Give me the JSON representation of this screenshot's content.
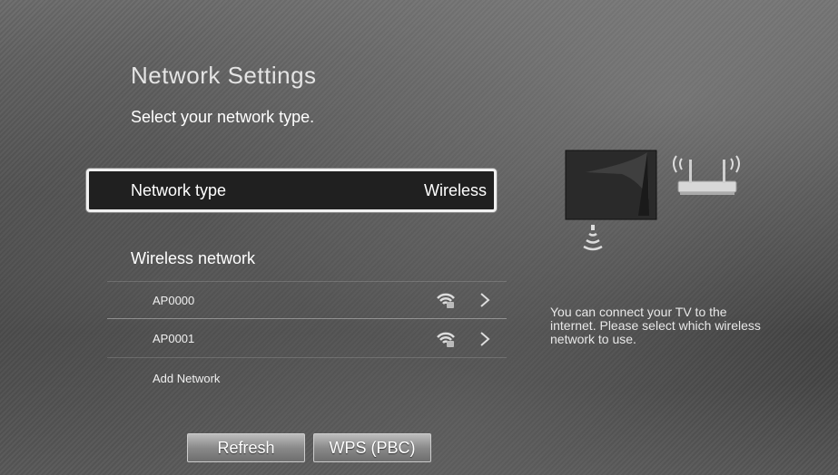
{
  "header": {
    "title": "Network Settings",
    "subtitle": "Select your network type."
  },
  "network_type": {
    "label": "Network type",
    "value": "Wireless"
  },
  "wireless_section": {
    "title": "Wireless network",
    "networks": [
      {
        "name": "AP0000",
        "icon": "wifi-signal-icon"
      },
      {
        "name": "AP0001",
        "icon": "wifi-signal-icon"
      }
    ],
    "add_network_label": "Add Network"
  },
  "buttons": {
    "refresh": "Refresh",
    "wps": "WPS (PBC)"
  },
  "info_text": "You can connect your TV to the internet. Please select which wireless network to use.",
  "illustration": {
    "icons": [
      "tv-icon",
      "router-icon",
      "wifi-signal-icon"
    ]
  },
  "colors": {
    "selected_bg": "#202020",
    "selected_border": "#f0f0f0",
    "text": "#ffffff"
  }
}
